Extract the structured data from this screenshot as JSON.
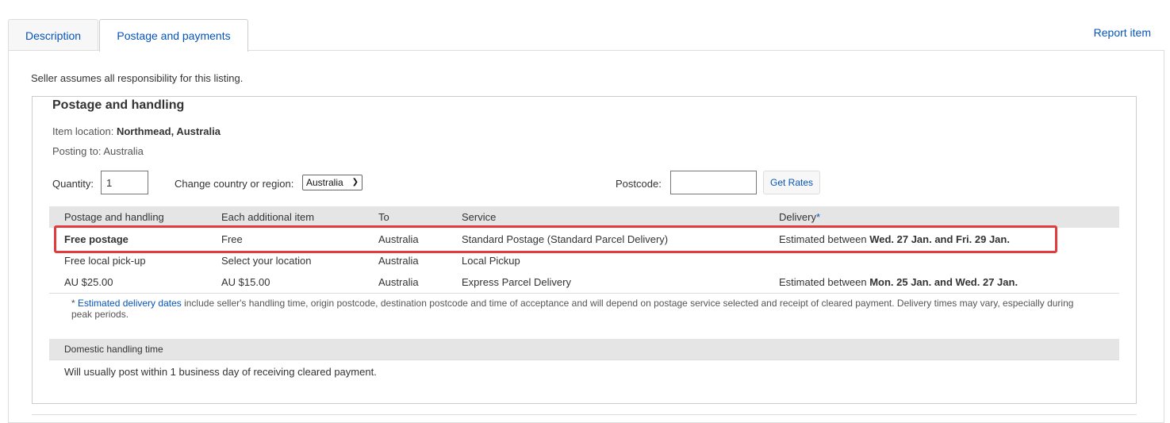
{
  "tabs": [
    {
      "label": "Description"
    },
    {
      "label": "Postage and payments"
    }
  ],
  "report_item": "Report item",
  "seller_note": "Seller assumes all responsibility for this listing.",
  "postage": {
    "heading": "Postage and handling",
    "item_location_label": "Item location:",
    "item_location_value": "Northmead, Australia",
    "posting_to": "Posting to: Australia",
    "quantity_label": "Quantity:",
    "quantity_value": "1",
    "country_label": "Change country or region:",
    "country_selected": "Australia",
    "postcode_label": "Postcode:",
    "get_rates": "Get Rates"
  },
  "table": {
    "headers": [
      "Postage and handling",
      "Each additional item",
      "To",
      "Service",
      "Delivery"
    ],
    "delivery_asterisk": "*",
    "rows": [
      {
        "handling": "Free postage",
        "additional": "Free",
        "to": "Australia",
        "service": "Standard Postage (Standard Parcel Delivery)",
        "delivery_prefix": "Estimated between ",
        "delivery_dates": "Wed. 27 Jan. and Fri. 29 Jan."
      },
      {
        "handling": "Free local pick-up",
        "additional": "Select your location",
        "to": "Australia",
        "service": "Local Pickup",
        "delivery_prefix": "",
        "delivery_dates": ""
      },
      {
        "handling": "AU $25.00",
        "additional": "AU $15.00",
        "to": "Australia",
        "service": "Express Parcel Delivery",
        "delivery_prefix": "Estimated between ",
        "delivery_dates": "Mon. 25 Jan. and Wed. 27 Jan."
      }
    ]
  },
  "footnote": {
    "star": "* ",
    "link": "Estimated delivery dates",
    "text": " include seller's handling time, origin postcode, destination postcode and time of acceptance and will depend on postage service selected and receipt of cleared payment. Delivery times may vary, especially during peak periods."
  },
  "domestic": {
    "heading": "Domestic handling time",
    "text": "Will usually post within 1 business day of receiving cleared payment."
  }
}
